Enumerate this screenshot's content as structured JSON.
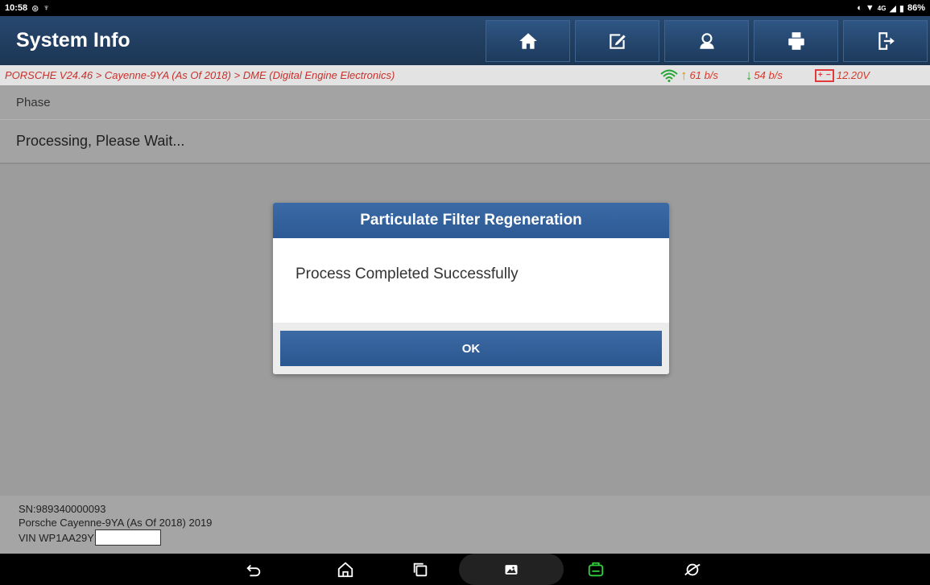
{
  "status_bar": {
    "time": "10:58",
    "network": "4G",
    "battery": "86%"
  },
  "app": {
    "title": "System Info",
    "toolbar": [
      "home-icon",
      "edit-report-icon",
      "support-icon",
      "print-icon",
      "exit-icon"
    ]
  },
  "breadcrumb": {
    "path": "PORSCHE V24.46 > Cayenne-9YA (As Of 2018) > DME (Digital Engine Electronics)",
    "upload_speed": "61 b/s",
    "download_speed": "54 b/s",
    "voltage": "12.20V"
  },
  "content": {
    "phase_label": "Phase",
    "status_text": "Processing, Please Wait..."
  },
  "dialog": {
    "title": "Particulate Filter Regeneration",
    "message": "Process Completed Successfully",
    "ok_label": "OK"
  },
  "footer": {
    "sn": "SN:989340000093",
    "vehicle": "Porsche Cayenne-9YA (As Of 2018) 2019",
    "vin_prefix": "VIN WP1AA29Y"
  },
  "colors": {
    "title_bar": "#1c3654",
    "dialog_header": "#2d5a94",
    "breadcrumb_text": "#c8312c"
  }
}
